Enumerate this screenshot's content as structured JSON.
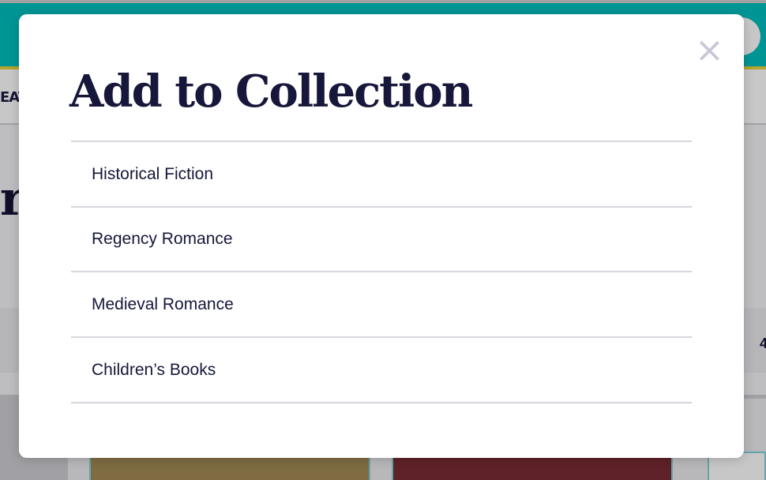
{
  "background": {
    "nav_text": "EAT",
    "hero_text": "r",
    "band_right_text": "4"
  },
  "modal": {
    "title": "Add to Collection",
    "close_icon": "×",
    "collections": [
      {
        "label": "Historical Fiction"
      },
      {
        "label": "Regency Romance"
      },
      {
        "label": "Medieval Romance"
      },
      {
        "label": "Children’s Books"
      }
    ]
  },
  "colors": {
    "topbar": "#00bfbf",
    "topbar_accent": "#e8d23a",
    "title_text": "#16173a",
    "divider": "#d6d6de",
    "close_icon": "#c7c7d5"
  }
}
